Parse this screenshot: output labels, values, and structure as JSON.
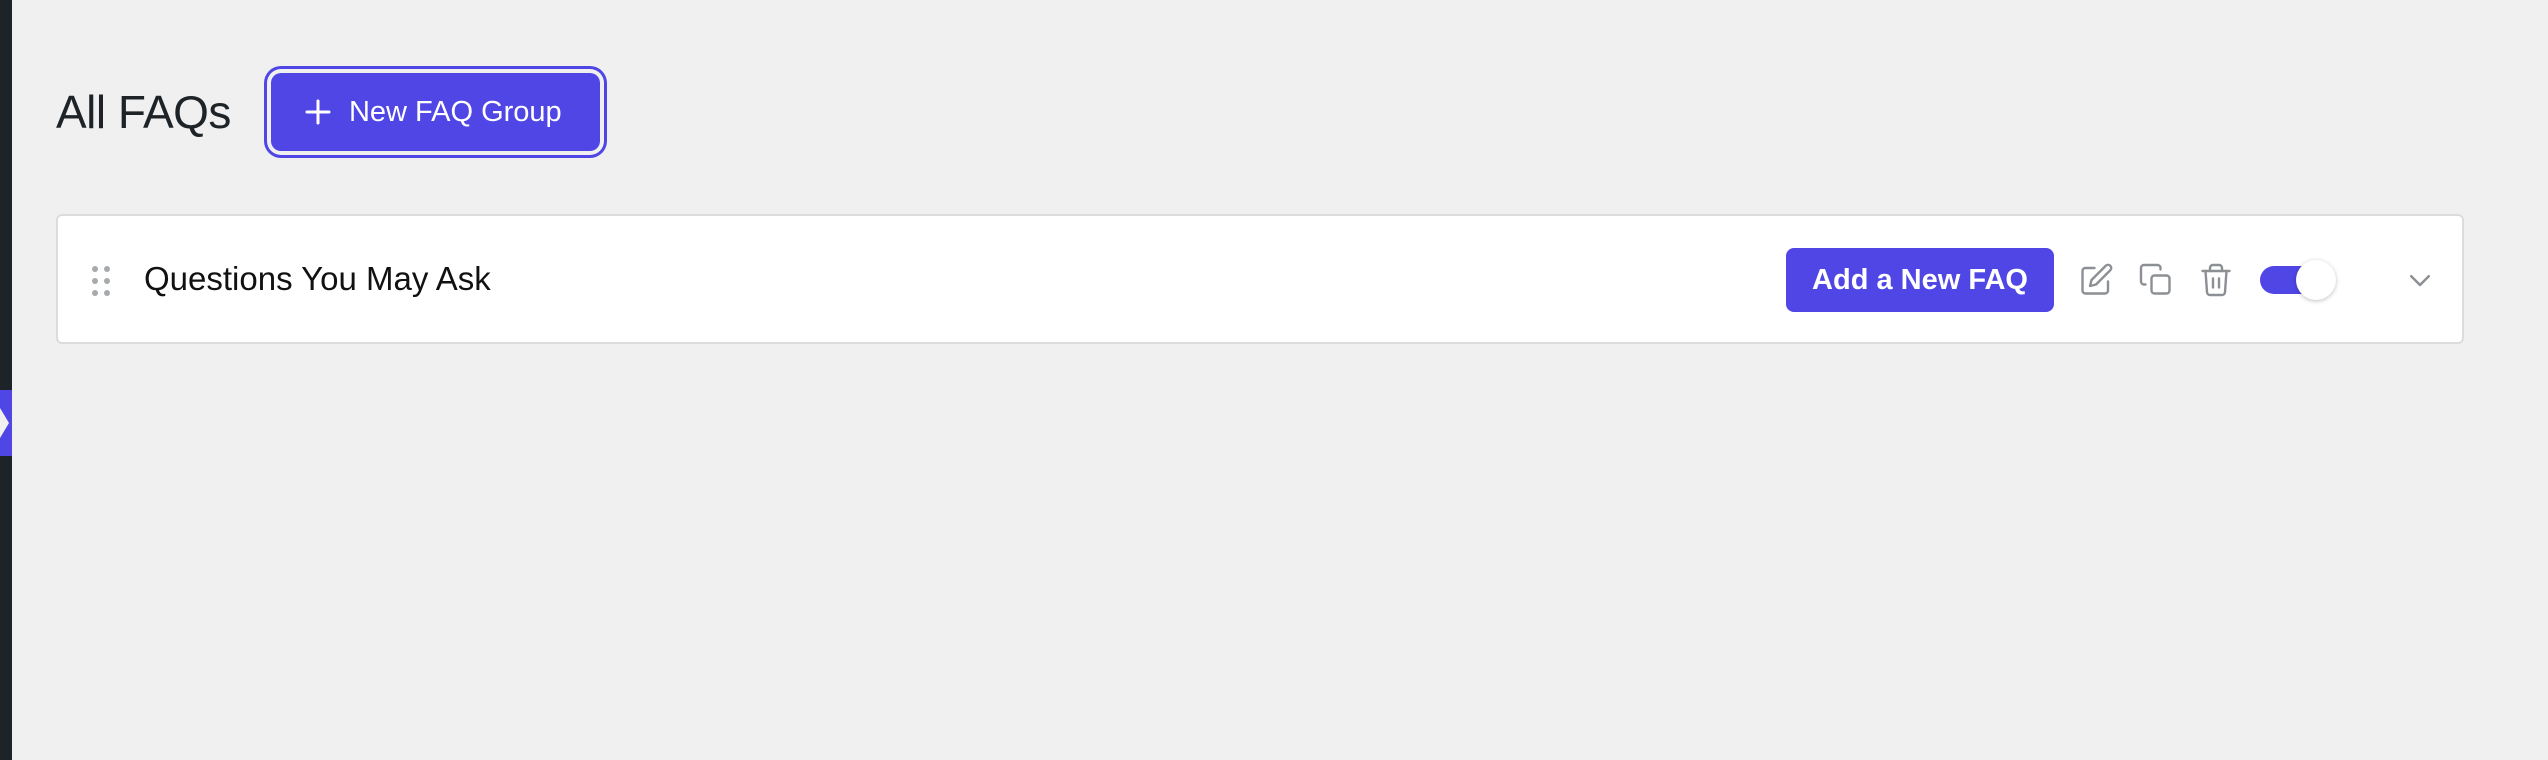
{
  "header": {
    "title": "All FAQs",
    "new_group_label": "New FAQ Group"
  },
  "faq_groups": [
    {
      "title": "Questions You May Ask",
      "add_faq_label": "Add a New FAQ",
      "enabled": true
    }
  ],
  "icons": {
    "plus": "plus-icon",
    "drag": "drag-handle-icon",
    "edit": "edit-icon",
    "copy": "copy-icon",
    "delete": "trash-icon",
    "expand": "chevron-down-icon"
  },
  "colors": {
    "accent": "#4f46e5",
    "background": "#f0f0f1",
    "card": "#ffffff",
    "icon": "#8c8f94"
  }
}
